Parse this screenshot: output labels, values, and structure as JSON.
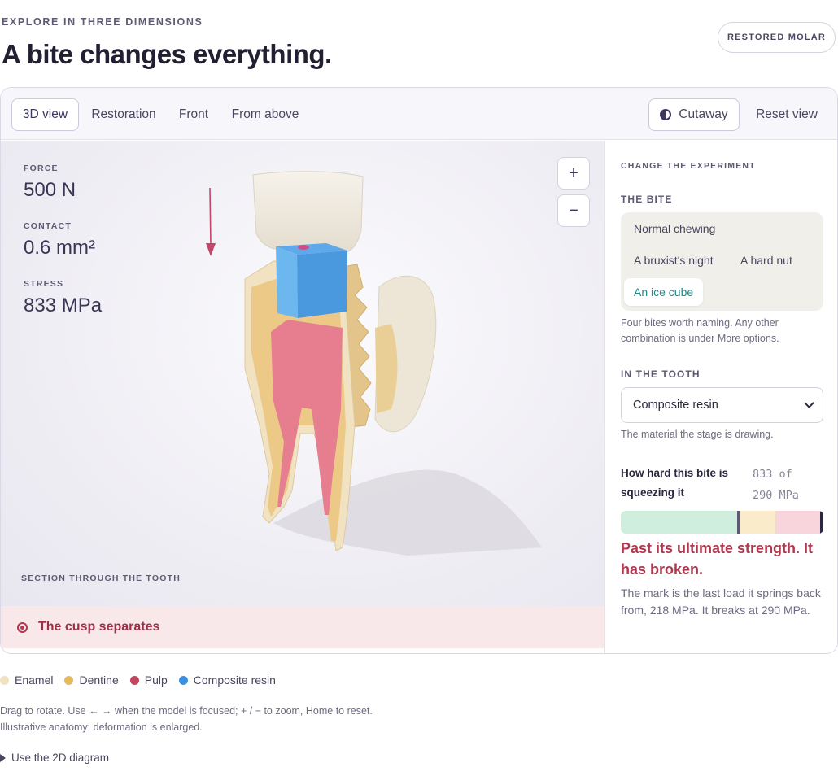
{
  "header": {
    "eyebrow": "EXPLORE IN THREE DIMENSIONS",
    "title": "A bite changes everything.",
    "pill_label": "RESTORED MOLAR"
  },
  "toolbar": {
    "views": [
      {
        "label": "3D view",
        "active": true
      },
      {
        "label": "Restoration",
        "active": false
      },
      {
        "label": "Front",
        "active": false
      },
      {
        "label": "From above",
        "active": false
      }
    ],
    "cutaway_label": "Cutaway",
    "reset_label": "Reset view"
  },
  "stage": {
    "metrics": [
      {
        "label": "FORCE",
        "value": "500 N"
      },
      {
        "label": "CONTACT",
        "value": "0.6 mm²"
      },
      {
        "label": "STRESS",
        "value": "833 MPa"
      }
    ],
    "zoom_in": "+",
    "zoom_out": "−",
    "section_label": "SECTION THROUGH THE TOOTH",
    "alert": "The cusp separates"
  },
  "panel": {
    "eyebrow": "CHANGE THE EXPERIMENT",
    "bite_heading": "THE BITE",
    "bites": [
      "Normal chewing",
      "A bruxist's night",
      "A hard nut",
      "An ice cube"
    ],
    "selected_bite": "An ice cube",
    "bite_help": "Four bites worth naming. Any other combination is under More options.",
    "tooth_heading": "IN THE TOOTH",
    "material_value": "Composite resin",
    "material_help": "The material the stage is drawing.",
    "meter_label": "How hard this bite is squeezing it",
    "meter_reading_top": "833 of",
    "meter_reading_bottom": "290 MPa",
    "meter": {
      "yield_mpa": 218,
      "ultimate_mpa": 290,
      "current_mpa": 833
    },
    "verdict": "Past its ultimate strength. It has broken.",
    "note": "The mark is the last load it springs back from, 218 MPa. It breaks at 290 MPa."
  },
  "legend": [
    {
      "label": "Enamel",
      "color": "#f1e2c2"
    },
    {
      "label": "Dentine",
      "color": "#e7b95e"
    },
    {
      "label": "Pulp",
      "color": "#c3455f"
    },
    {
      "label": "Composite resin",
      "color": "#3a8fe0"
    }
  ],
  "footnote": {
    "line1": "Drag to rotate. Use ← → when the model is focused; + / − to zoom, Home to reset.",
    "line2": "Illustrative anatomy; deformation is enlarged."
  },
  "details_label": "Use the 2D diagram",
  "colors": {
    "accent": "#3d3760",
    "alert": "#b0394f",
    "selected": "#1f8a8a"
  }
}
